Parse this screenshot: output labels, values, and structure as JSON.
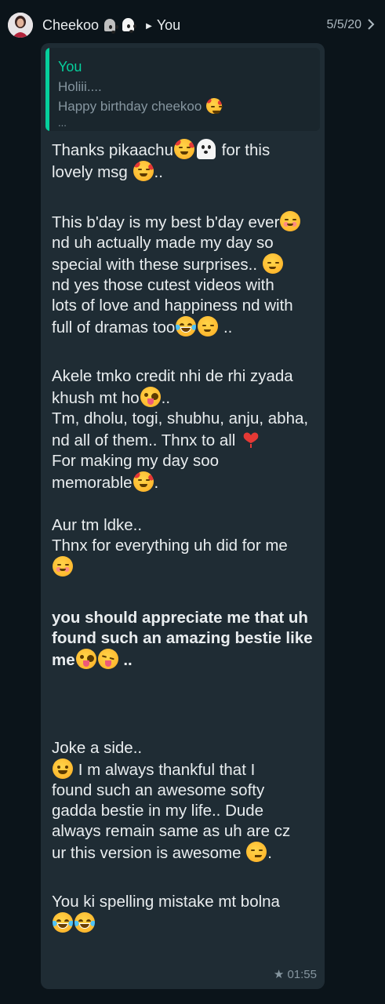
{
  "header": {
    "sender": "Cheekoo",
    "recipient": "You",
    "date": "5/5/20"
  },
  "quote": {
    "author": "You",
    "lines": [
      "Holiii....",
      "Happy birthday cheekoo",
      "..."
    ]
  },
  "message": {
    "p1": [
      "Thanks pikaachu",
      " for this",
      "lovely msg",
      ".."
    ],
    "p2": [
      "This b'day is my best b'day ever",
      "nd uh actually made my day so",
      "special with these surprises.. ",
      "nd yes those cutest videos with",
      "lots of love and happiness nd with",
      "full of dramas too",
      " .."
    ],
    "p3": [
      "Akele tmko credit nhi de rhi zyada",
      "khush mt ho",
      "..",
      "Tm, dholu, togi, shubhu, anju, abha,",
      "nd all of them.. Thnx to all ",
      "For making my day soo",
      "memorable",
      "."
    ],
    "p4": [
      "Aur tm ldke..",
      "Thnx for everything uh did for me"
    ],
    "p5": [
      " you should appreciate me that uh",
      "found such an amazing bestie like",
      "me",
      " .."
    ],
    "p6": [
      "Joke a side..",
      " I m always thankful that I",
      "found such an awesome softy",
      "gadda bestie in my life.. Dude",
      "always remain same as uh are cz",
      "ur this version is awesome ",
      "."
    ],
    "p7": [
      "You ki spelling mistake mt bolna"
    ]
  },
  "meta": {
    "starred": true,
    "time": "01:55"
  },
  "colors": {
    "background": "#0b141a",
    "bubble": "#1f2c34",
    "accent": "#06cf9c"
  }
}
